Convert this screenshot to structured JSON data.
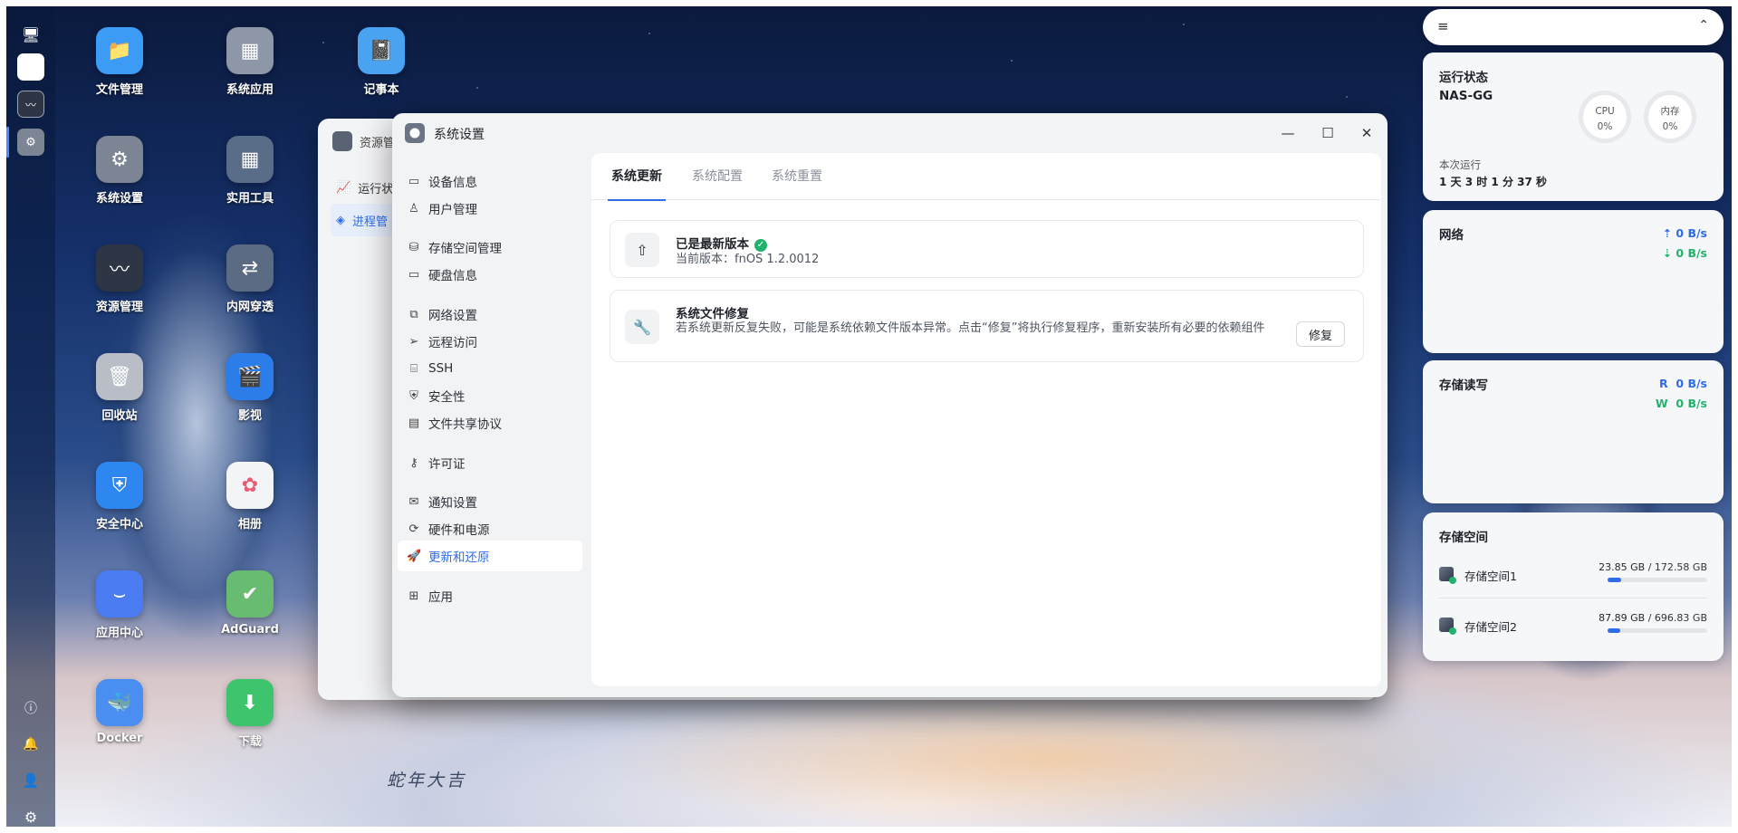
{
  "desktop": {
    "caption": "蛇年大吉",
    "icons": [
      {
        "label": "文件管理",
        "icon": "folder-icon",
        "color": "#3b9bf5"
      },
      {
        "label": "系统应用",
        "icon": "app-grid-icon",
        "color": "#8d97a8"
      },
      {
        "label": "记事本",
        "icon": "notebook-icon",
        "color": "#4aa3f0"
      },
      {
        "label": "系统设置",
        "icon": "gear-icon",
        "color": "#7c8594"
      },
      {
        "label": "实用工具",
        "icon": "tools-grid-icon",
        "color": "#5a6d88"
      },
      {
        "label": "资源管理",
        "icon": "pulse-icon",
        "color": "#2e3645"
      },
      {
        "label": "内网穿透",
        "icon": "tunnel-icon",
        "color": "#5b6b83"
      },
      {
        "label": "回收站",
        "icon": "trash-icon",
        "color": "#b9bec6"
      },
      {
        "label": "影视",
        "icon": "film-icon",
        "color": "#2b7de9"
      },
      {
        "label": "安全中心",
        "icon": "shield-icon",
        "color": "#2e86f0"
      },
      {
        "label": "相册",
        "icon": "photos-icon",
        "color": "#f3f4f6"
      },
      {
        "label": "应用中心",
        "icon": "store-icon",
        "color": "#4a7bf0"
      },
      {
        "label": "AdGuard",
        "icon": "adguard-icon",
        "color": "#68bc71"
      },
      {
        "label": "Docker",
        "icon": "docker-icon",
        "color": "#4b8ef2"
      },
      {
        "label": "下载",
        "icon": "download-icon",
        "color": "#3ec46d"
      }
    ]
  },
  "back_window": {
    "title": "资源管",
    "nav": [
      "运行状",
      "进程管"
    ]
  },
  "window": {
    "title": "系统设置",
    "controls": {
      "minimize": "—",
      "maximize": "☐",
      "close": "✕"
    },
    "sidebar": [
      {
        "label": "设备信息",
        "icon": "drive-icon"
      },
      {
        "label": "用户管理",
        "icon": "user-icon"
      },
      {
        "label": "存储空间管理",
        "icon": "storage-icon"
      },
      {
        "label": "硬盘信息",
        "icon": "disk-icon"
      },
      {
        "label": "网络设置",
        "icon": "network-icon"
      },
      {
        "label": "远程访问",
        "icon": "send-icon"
      },
      {
        "label": "SSH",
        "icon": "terminal-icon"
      },
      {
        "label": "安全性",
        "icon": "shield-icon"
      },
      {
        "label": "文件共享协议",
        "icon": "file-icon"
      },
      {
        "label": "许可证",
        "icon": "key-icon"
      },
      {
        "label": "通知设置",
        "icon": "mail-icon"
      },
      {
        "label": "硬件和电源",
        "icon": "power-icon"
      },
      {
        "label": "更新和还原",
        "icon": "rocket-icon",
        "selected": true
      },
      {
        "label": "应用",
        "icon": "apps-icon"
      }
    ],
    "tabs": [
      "系统更新",
      "系统配置",
      "系统重置"
    ],
    "active_tab": "系统更新",
    "update_card": {
      "title": "已是最新版本",
      "version_line": "当前版本：fnOS 1.2.0012"
    },
    "repair_card": {
      "title": "系统文件修复",
      "description": "若系统更新反复失败，可能是系统依赖文件版本异常。点击“修复”将执行修复程序，重新安装所有必要的依赖组件",
      "button": "修复"
    }
  },
  "widgets": {
    "status": {
      "title": "运行状态",
      "hostname": "NAS-GG",
      "cpu_label": "CPU",
      "cpu_value": "0%",
      "mem_label": "内存",
      "mem_value": "0%",
      "uptime_label": "本次运行",
      "uptime_value": "1 天 3 时 1 分 37 秒"
    },
    "network": {
      "title": "网络",
      "up": "0 B/s",
      "down": "0 B/s"
    },
    "disk_io": {
      "title": "存储读写",
      "read_label": "R",
      "read": "0 B/s",
      "write_label": "W",
      "write": "0 B/s"
    },
    "storage": {
      "title": "存储空间",
      "volumes": [
        {
          "name": "存储空间1",
          "used": "23.85 GB",
          "total": "/ 172.58 GB",
          "fraction": 0.138
        },
        {
          "name": "存储空间2",
          "used": "87.89 GB",
          "total": "/ 696.83 GB",
          "fraction": 0.126
        }
      ]
    }
  },
  "colors": {
    "accent": "#2f6ce5",
    "ok": "#23b26d",
    "upload": "#2f6ce5",
    "download": "#23b26d"
  }
}
